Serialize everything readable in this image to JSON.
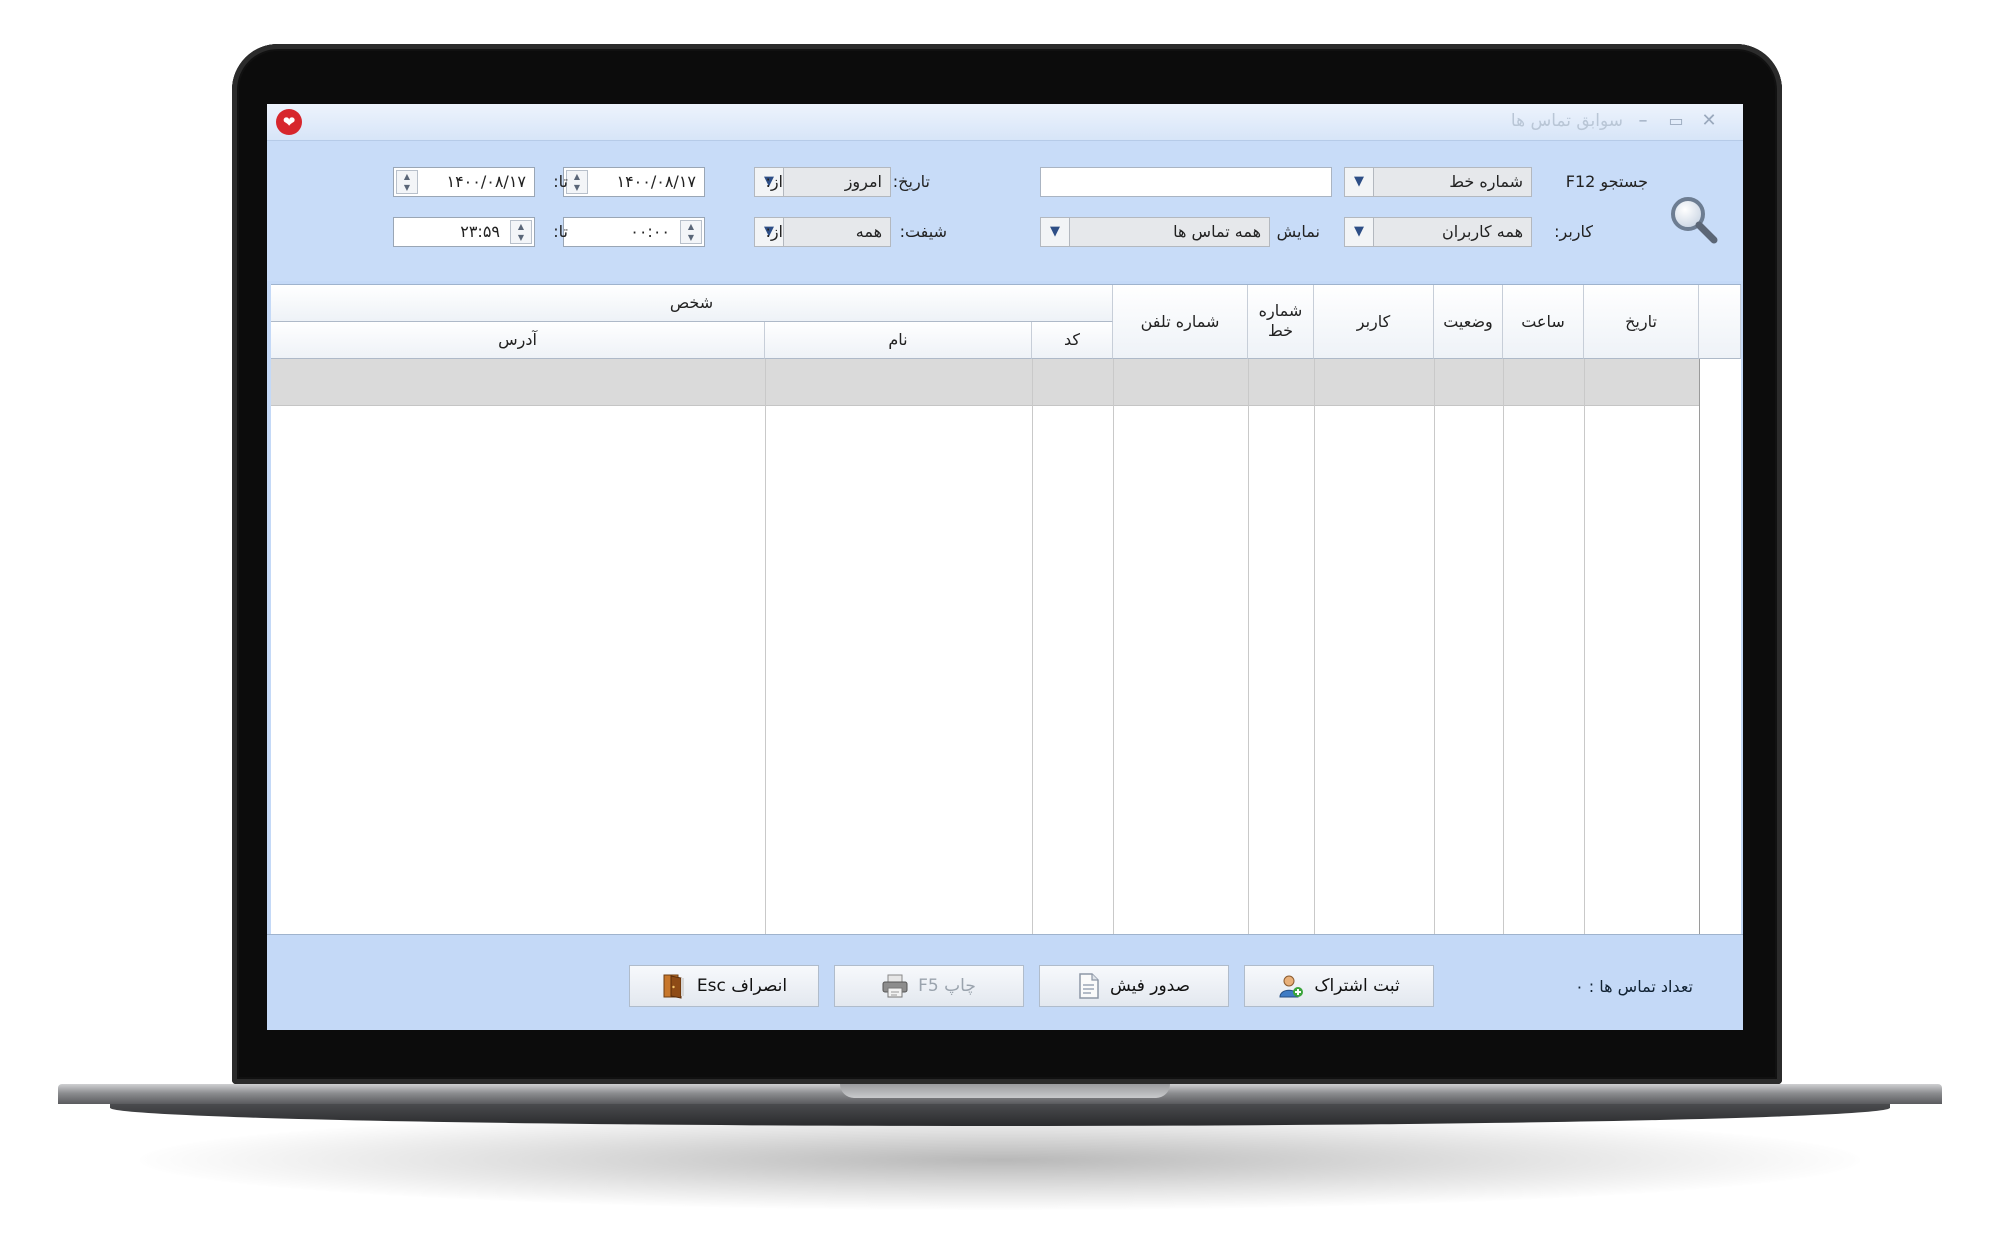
{
  "window": {
    "title": "سوابق تماس ها",
    "minimize_glyph": "–",
    "maximize_glyph": "▭",
    "close_glyph": "✕"
  },
  "filters": {
    "search_label": "جستجو F12",
    "search_field_select": "شماره خط",
    "search_value": "",
    "user_label": "کاربر:",
    "user_select": "همه کاربران",
    "display_label": "نمایش",
    "display_select": "همه تماس ها",
    "date_label": "تاریخ:",
    "date_select": "امروز",
    "shift_label": "شیفت:",
    "shift_select": "همه",
    "from_label": "از:",
    "to_label": "تا:",
    "date_from": "۱۴۰۰/۰۸/۱۷",
    "date_to": "۱۴۰۰/۰۸/۱۷",
    "time_from": "۰۰:۰۰",
    "time_to": "۲۳:۵۹"
  },
  "table": {
    "columns": {
      "date": "تاریخ",
      "time": "ساعت",
      "status": "وضعیت",
      "user": "کاربر",
      "line": "شماره خط",
      "phone": "شماره تلفن",
      "person_group": "شخص",
      "code": "کد",
      "name": "نام",
      "address": "آدرس"
    },
    "rows": []
  },
  "footer": {
    "count_label": "تعداد تماس ها :",
    "count_value": "۰",
    "subscribe_button": "ثبت اشتراک",
    "receipt_button": "صدور فیش",
    "print_button": "چاپ F5",
    "cancel_button": "انصراف Esc"
  },
  "colors": {
    "window_bg": "#c4d9f7",
    "selected_row": "#dadada",
    "logo_red": "#d7262c"
  }
}
